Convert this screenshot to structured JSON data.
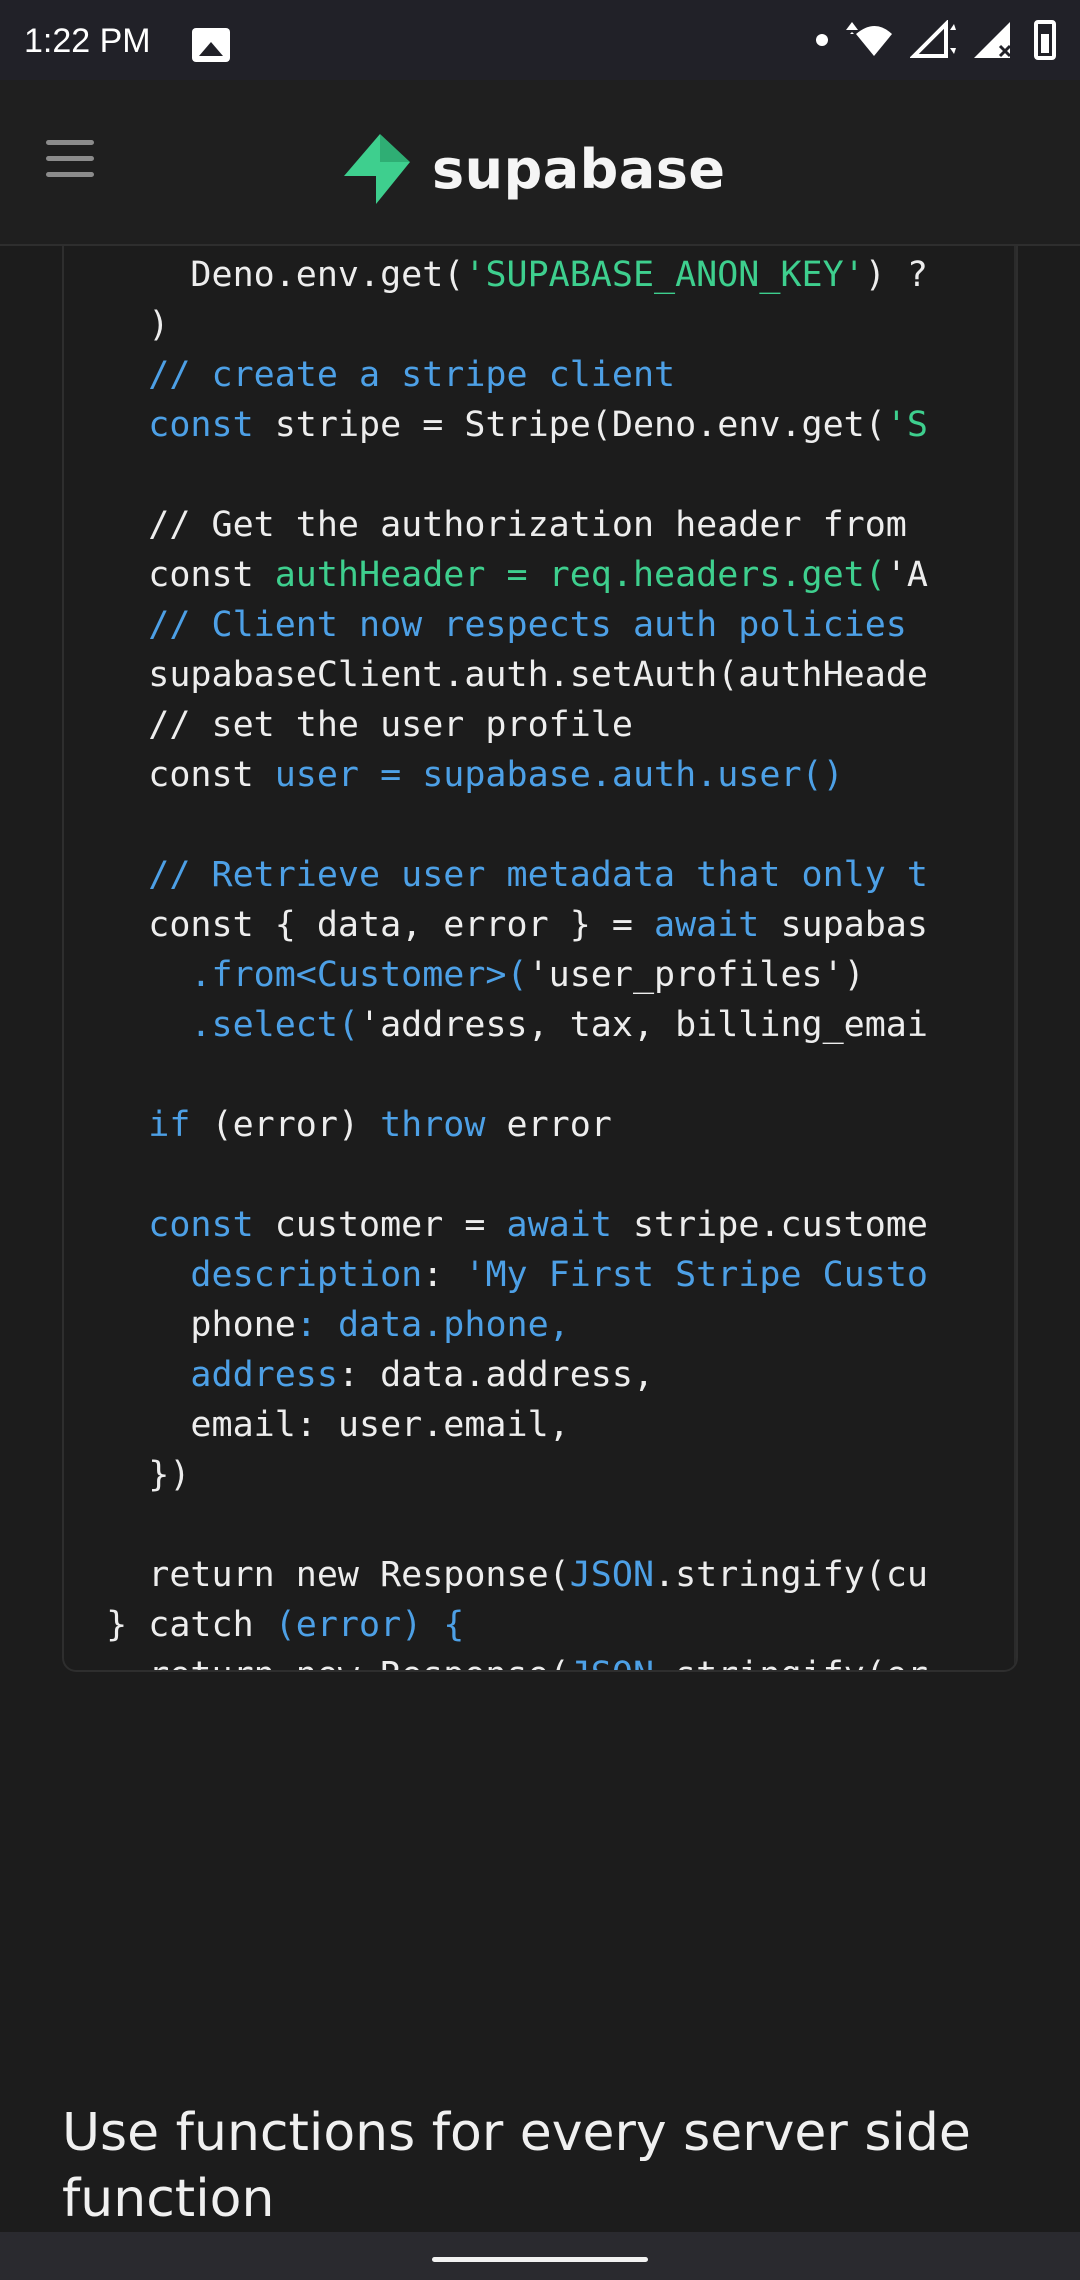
{
  "status_bar": {
    "time": "1:22 PM",
    "icons": [
      "gallery-icon",
      "dot-icon",
      "wifi-icon",
      "signal-icon",
      "signal-x-icon",
      "battery-icon"
    ]
  },
  "header": {
    "menu_icon": "hamburger-icon",
    "logo_icon": "supabase-bolt-icon",
    "logo_text": "supabase",
    "brand_color": "#3ecf8e"
  },
  "code": {
    "lines": [
      [
        [
          "c-white",
          "      Deno.env.get("
        ],
        [
          "c-green",
          "'SUPABASE_ANON_KEY'"
        ],
        [
          "c-white",
          ") ?"
        ]
      ],
      [
        [
          "c-white",
          "    )"
        ]
      ],
      [
        [
          "c-blue",
          "    // create a stripe client"
        ]
      ],
      [
        [
          "c-blue",
          "    const"
        ],
        [
          "c-white",
          " stripe = Stripe(Deno.env.get("
        ],
        [
          "c-green",
          "'S"
        ]
      ],
      [
        [
          "c-white",
          ""
        ]
      ],
      [
        [
          "c-white",
          "    // Get the authorization header from"
        ]
      ],
      [
        [
          "c-white",
          "    const "
        ],
        [
          "c-green",
          "authHeader = req.headers.get("
        ],
        [
          "c-white",
          "'A"
        ]
      ],
      [
        [
          "c-blue",
          "    // Client now respects auth policies"
        ]
      ],
      [
        [
          "c-white",
          "    supabaseClient.auth.setAuth(authHeade"
        ]
      ],
      [
        [
          "c-white",
          "    // set the user profile"
        ]
      ],
      [
        [
          "c-white",
          "    const "
        ],
        [
          "c-blue",
          "user = supabase.auth.user()"
        ]
      ],
      [
        [
          "c-white",
          ""
        ]
      ],
      [
        [
          "c-blue",
          "    // Retrieve user metadata that only t"
        ]
      ],
      [
        [
          "c-white",
          "    const { data, error } = "
        ],
        [
          "c-blue",
          "await"
        ],
        [
          "c-white",
          " supabas"
        ]
      ],
      [
        [
          "c-blue",
          "      .from<Customer>("
        ],
        [
          "c-white",
          "'user_profiles')"
        ]
      ],
      [
        [
          "c-blue",
          "      .select("
        ],
        [
          "c-white",
          "'address, tax, billing_emai"
        ]
      ],
      [
        [
          "c-white",
          ""
        ]
      ],
      [
        [
          "c-blue",
          "    if"
        ],
        [
          "c-white",
          " (error) "
        ],
        [
          "c-blue",
          "throw"
        ],
        [
          "c-white",
          " error"
        ]
      ],
      [
        [
          "c-white",
          ""
        ]
      ],
      [
        [
          "c-blue",
          "    const"
        ],
        [
          "c-white",
          " customer = "
        ],
        [
          "c-blue",
          "await"
        ],
        [
          "c-white",
          " stripe.custome"
        ]
      ],
      [
        [
          "c-blue",
          "      description"
        ],
        [
          "c-white",
          ": "
        ],
        [
          "c-blue",
          "'My First Stripe Custo"
        ]
      ],
      [
        [
          "c-white",
          "      phone"
        ],
        [
          "c-blue",
          ": data.phone,"
        ]
      ],
      [
        [
          "c-blue",
          "      address"
        ],
        [
          "c-white",
          ": data.address,"
        ]
      ],
      [
        [
          "c-white",
          "      email: user.email,"
        ]
      ],
      [
        [
          "c-white",
          "    })"
        ]
      ],
      [
        [
          "c-white",
          ""
        ]
      ],
      [
        [
          "c-white",
          "    return new Response("
        ],
        [
          "c-blue",
          "JSON"
        ],
        [
          "c-white",
          ".stringify(cu"
        ]
      ],
      [
        [
          "c-white",
          "  } catch "
        ],
        [
          "c-blue",
          "(error) {"
        ]
      ],
      [
        [
          "c-white",
          "    return new Response("
        ],
        [
          "c-blue",
          "JSON"
        ],
        [
          "c-white",
          ".stringify(er"
        ]
      ]
    ]
  },
  "content": {
    "heading": "Use functions for every server side function"
  },
  "nav_bar": {
    "home_indicator": "home-pill"
  }
}
